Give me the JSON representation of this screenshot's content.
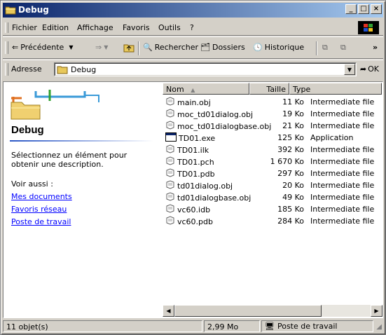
{
  "window": {
    "title": "Debug"
  },
  "title_buttons": {
    "minimize": "_",
    "maximize": "□",
    "close": "×"
  },
  "menu": [
    "Fichier",
    "Edition",
    "Affichage",
    "Favoris",
    "Outils",
    "?"
  ],
  "toolbar": {
    "back": "Précédente",
    "search": "Rechercher",
    "folders": "Dossiers",
    "history": "Historique",
    "more": "»"
  },
  "address": {
    "label": "Adresse",
    "value": "Debug",
    "go": "OK"
  },
  "left_pane": {
    "folder_title": "Debug",
    "description": "Sélectionnez un élément pour obtenir une description.",
    "see_also": "Voir aussi :",
    "links": [
      "Mes documents",
      "Favoris réseau",
      "Poste de travail"
    ]
  },
  "columns": {
    "name": "Nom",
    "size": "Taille",
    "type": "Type"
  },
  "files": [
    {
      "name": "main.obj",
      "size": "11 Ko",
      "type": "Intermediate file",
      "icon": "generic-file-icon"
    },
    {
      "name": "moc_td01dialog.obj",
      "size": "19 Ko",
      "type": "Intermediate file",
      "icon": "generic-file-icon"
    },
    {
      "name": "moc_td01dialogbase.obj",
      "size": "21 Ko",
      "type": "Intermediate file",
      "icon": "generic-file-icon"
    },
    {
      "name": "TD01.exe",
      "size": "125 Ko",
      "type": "Application",
      "icon": "application-icon"
    },
    {
      "name": "TD01.ilk",
      "size": "392 Ko",
      "type": "Intermediate file",
      "icon": "generic-file-icon"
    },
    {
      "name": "TD01.pch",
      "size": "1 670 Ko",
      "type": "Intermediate file",
      "icon": "generic-file-icon"
    },
    {
      "name": "TD01.pdb",
      "size": "297 Ko",
      "type": "Intermediate file",
      "icon": "generic-file-icon"
    },
    {
      "name": "td01dialog.obj",
      "size": "20 Ko",
      "type": "Intermediate file",
      "icon": "generic-file-icon"
    },
    {
      "name": "td01dialogbase.obj",
      "size": "49 Ko",
      "type": "Intermediate file",
      "icon": "generic-file-icon"
    },
    {
      "name": "vc60.idb",
      "size": "185 Ko",
      "type": "Intermediate file",
      "icon": "generic-file-icon"
    },
    {
      "name": "vc60.pdb",
      "size": "284 Ko",
      "type": "Intermediate file",
      "icon": "generic-file-icon"
    }
  ],
  "status": {
    "count": "11 objet(s)",
    "total_size": "2,99 Mo",
    "zone": "Poste de travail"
  },
  "colors": {
    "title_start": "#0a246a",
    "title_end": "#a6caf0",
    "chrome": "#d4d0c8",
    "link": "#0000ff"
  }
}
